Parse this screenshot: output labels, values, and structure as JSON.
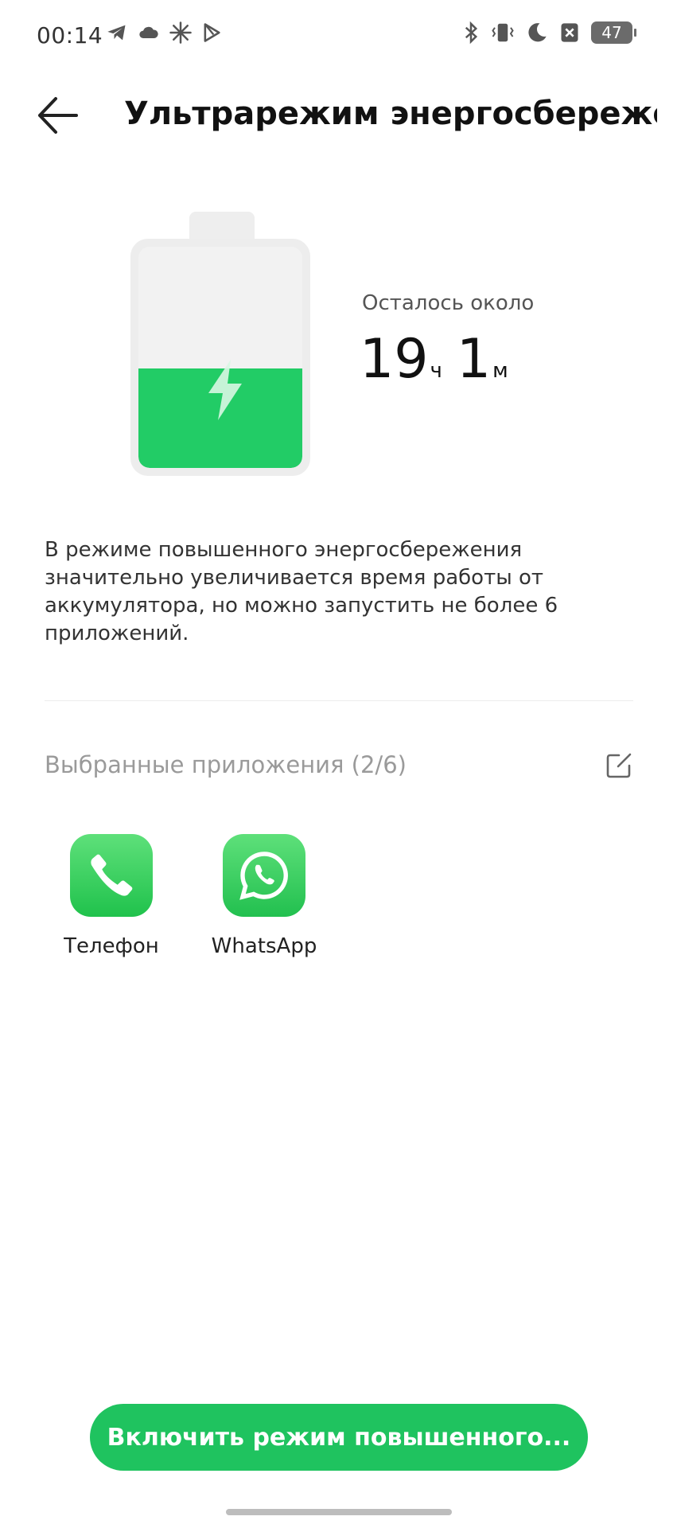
{
  "status_bar": {
    "time": "00:14",
    "left_icons": [
      "telegram-icon",
      "cloud-icon",
      "flash-burst-icon",
      "play-store-icon"
    ],
    "right_icons": [
      "bluetooth-icon",
      "vibrate-icon",
      "moon-icon",
      "no-sim-icon"
    ],
    "battery_level": "47"
  },
  "header": {
    "title": "Ультрарежим энергосбереже..."
  },
  "battery": {
    "fill_level": 0.45,
    "fill_color": "#22cc66",
    "icon": "lightning-bolt-icon"
  },
  "remaining": {
    "label": "Осталось около",
    "hours": "19",
    "hours_unit": "ч",
    "minutes": "1",
    "minutes_unit": "м"
  },
  "description": "В режиме повышенного энергосбережения значительно увеличивается время работы от аккумулятора, но можно запустить не более 6 приложений.",
  "selected_apps": {
    "label": "Выбранные приложения (2/6)",
    "edit_icon": "edit-icon",
    "apps": [
      {
        "label": "Телефон",
        "icon": "phone-icon",
        "color": "#2fd158"
      },
      {
        "label": "WhatsApp",
        "icon": "whatsapp-icon",
        "color": "#25d366"
      }
    ]
  },
  "action_button": {
    "label": "Включить режим повышенного..."
  },
  "colors": {
    "accent": "#1fc35f"
  }
}
